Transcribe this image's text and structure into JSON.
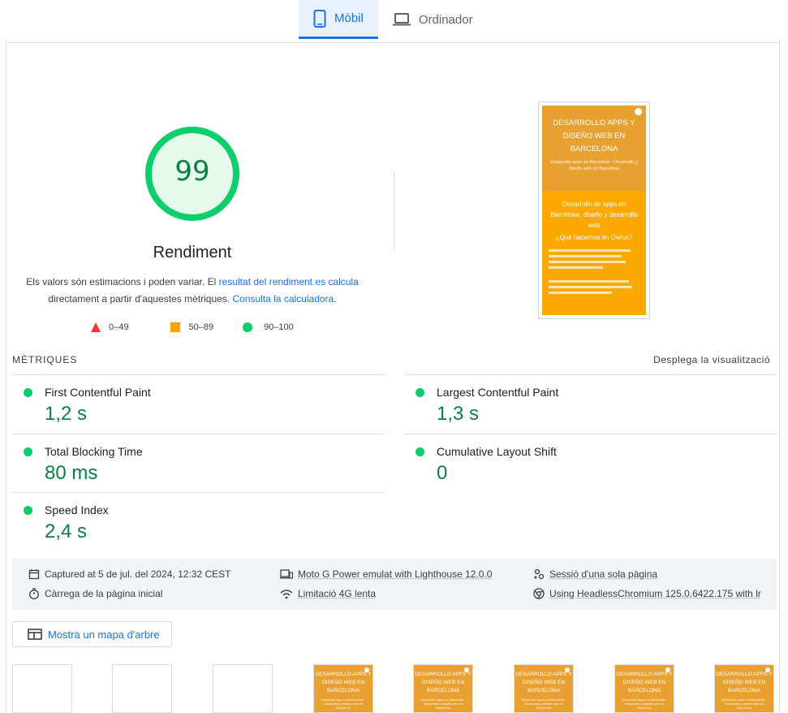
{
  "tabs": [
    {
      "label": "Mòbil",
      "icon": "smartphone-icon",
      "active": true
    },
    {
      "label": "Ordinador",
      "icon": "laptop-icon",
      "active": false
    }
  ],
  "score": {
    "value": "99",
    "title": "Rendiment",
    "desc_1": "Els valors són estimacions i poden variar. El ",
    "desc_link_1": "resultat del rendiment es calcula",
    "desc_2": " directament a partir d'aquestes mètriques. ",
    "desc_link_2": "Consulta la calculadora",
    "desc_3": ".",
    "color": "#0cce6b",
    "fill": "#e6f9ed",
    "text_color": "#0b8043"
  },
  "legend": [
    {
      "label": "0–49",
      "shape": "triangle",
      "color": "#f33"
    },
    {
      "label": "50–89",
      "shape": "square",
      "color": "#ffa400"
    },
    {
      "label": "90–100",
      "shape": "circle",
      "color": "#0cce6b"
    }
  ],
  "screenshot": {
    "heading": "DESARROLLO APPS Y DISEÑO WEB EN BARCELONA",
    "subheading": "Desarrollo apps en Barcelona - Desarrollo y diseño web en Barcelona",
    "body_title": "Desarrollo de apps en Barcelona, diseño y desarrollo web",
    "body_question": "¿Qué hacemos en Owius?"
  },
  "metrics": {
    "heading": "MÈTRIQUES",
    "toggle": "Desplega la visualització",
    "items": [
      {
        "name": "First Contentful Paint",
        "value": "1,2 s"
      },
      {
        "name": "Largest Contentful Paint",
        "value": "1,3 s"
      },
      {
        "name": "Total Blocking Time",
        "value": "80 ms"
      },
      {
        "name": "Cumulative Layout Shift",
        "value": "0"
      },
      {
        "name": "Speed Index",
        "value": "2,4 s"
      }
    ]
  },
  "runtime": {
    "captured": "Captured at 5 de jul. del 2024, 12:32 CEST",
    "device": "Moto G Power emulat with Lighthouse 12.0.0",
    "session": "Sessió d'una sola pàgina",
    "load": "Càrrega de la pàgina inicial",
    "throttle": "Limitació 4G lenta",
    "browser": "Using HeadlessChromium 125.0.6422.175 with lr"
  },
  "treemap_label": "Mostra un mapa d'arbre",
  "filmstrip": {
    "frame_title": "DESARROLLO APPS Y DISEÑO WEB EN BARCELONA",
    "frame_sub": "Desarrollo apps en Barcelona - Desarrollo y diseño web en Barcelona"
  }
}
